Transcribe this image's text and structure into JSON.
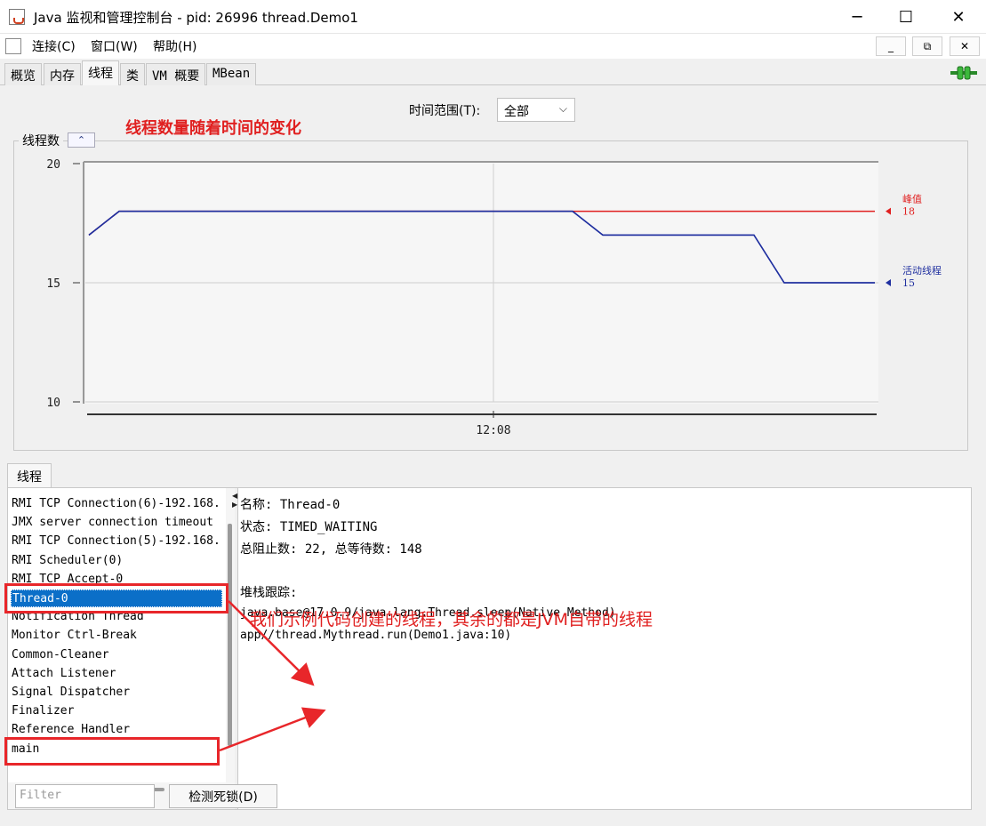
{
  "window": {
    "title": "Java 监视和管理控制台 - pid: 26996 thread.Demo1",
    "minimize_glyph": "─",
    "maximize_glyph": "☐",
    "close_glyph": "✕"
  },
  "menu": {
    "items": [
      "连接(C)",
      "窗口(W)",
      "帮助(H)"
    ],
    "mdi_buttons": [
      "_",
      "⧉",
      "✕"
    ]
  },
  "tabs": [
    {
      "label": "概览",
      "active": false
    },
    {
      "label": "内存",
      "active": false
    },
    {
      "label": "线程",
      "active": true
    },
    {
      "label": "类",
      "active": false
    },
    {
      "label": "VM 概要",
      "active": false
    },
    {
      "label": "MBean",
      "active": false
    }
  ],
  "time_range": {
    "label": "时间范围(T):",
    "selected": "全部"
  },
  "annotations": {
    "top": "线程数量随着时间的变化",
    "bottom": "我们示例代码创建的线程，其余的都是JVM自带的线程"
  },
  "chart_panel": {
    "title": "线程数",
    "collapse_glyph": "⌃"
  },
  "chart_data": {
    "type": "line",
    "title": "线程数",
    "xlabel": "",
    "ylabel": "",
    "x_tick_labels": [
      "12:08"
    ],
    "y_ticks": [
      10,
      15,
      20
    ],
    "ylim": [
      10,
      20
    ],
    "grid": true,
    "legend_placement": "right",
    "series": [
      {
        "name": "峰值",
        "color": "#e02020",
        "last_value": 18,
        "values": [
          17,
          18,
          18,
          18,
          18,
          18,
          18,
          18,
          18,
          18,
          18,
          18,
          18,
          18,
          18,
          18,
          18,
          18,
          18,
          18,
          18,
          18,
          18,
          18,
          18,
          18,
          18
        ]
      },
      {
        "name": "活动线程",
        "color": "#2030a0",
        "last_value": 15,
        "values": [
          17,
          18,
          18,
          18,
          18,
          18,
          18,
          18,
          18,
          18,
          18,
          18,
          18,
          18,
          18,
          18,
          18,
          17,
          17,
          17,
          17,
          17,
          17,
          15,
          15,
          15,
          15
        ]
      }
    ]
  },
  "thread_tab": {
    "label": "线程"
  },
  "threads": {
    "items": [
      "RMI TCP Connection(6)-192.168.",
      "JMX server connection timeout",
      "RMI TCP Connection(5)-192.168.",
      "RMI Scheduler(0)",
      "RMI TCP Accept-0",
      "Thread-0",
      "Notification Thread",
      "Monitor Ctrl-Break",
      "Common-Cleaner",
      "Attach Listener",
      "Signal Dispatcher",
      "Finalizer",
      "Reference Handler",
      "main"
    ],
    "selected": "Thread-0"
  },
  "details": {
    "name": "名称: Thread-0",
    "state": "状态: TIMED_WAITING",
    "counts": "总阻止数: 22, 总等待数: 148",
    "stack_title": "堆栈跟踪:",
    "stack": [
      "java.base@17.0.9/java.lang.Thread.sleep(Native Method)",
      "app//thread.Mythread.run(Demo1.java:10)"
    ]
  },
  "filter": {
    "placeholder": "Filter"
  },
  "deadlock_button": {
    "label": "检测死锁(D)"
  },
  "colors": {
    "peak": "#e02020",
    "live": "#2030a0",
    "selection": "#0b6fc8",
    "annotation": "#e8262a"
  }
}
